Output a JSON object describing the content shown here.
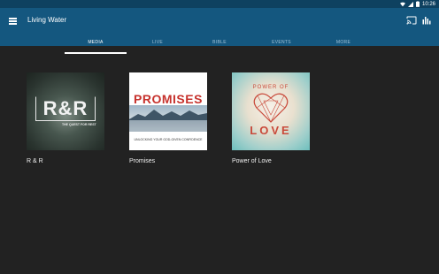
{
  "status_bar": {
    "time": "10:26",
    "icons": [
      "wifi-icon",
      "signal-icon",
      "battery-icon"
    ]
  },
  "app_bar": {
    "title": "Living Water",
    "menu_icon": "menu-icon",
    "actions": [
      "cast-icon",
      "stats-icon"
    ]
  },
  "tabs": [
    {
      "label": "MEDIA",
      "active": true
    },
    {
      "label": "LIVE",
      "active": false
    },
    {
      "label": "BIBLE",
      "active": false
    },
    {
      "label": "EVENTS",
      "active": false
    },
    {
      "label": "MORE",
      "active": false
    }
  ],
  "media": [
    {
      "title": "R & R",
      "thumb_text": "R&R",
      "thumb_subtext": "THE QUEST FOR REST"
    },
    {
      "title": "Promises",
      "thumb_text": "PROMISES",
      "thumb_subtext": "UNLOCKING YOUR GOD-GIVEN CONFIDENCE"
    },
    {
      "title": "Power of Love",
      "thumb_text_top": "POWER OF",
      "thumb_text": "LOVE"
    }
  ],
  "colors": {
    "status_bar": "#0e4160",
    "app_bar": "#14577f",
    "background": "#222222",
    "accent_red": "#c6312c"
  }
}
